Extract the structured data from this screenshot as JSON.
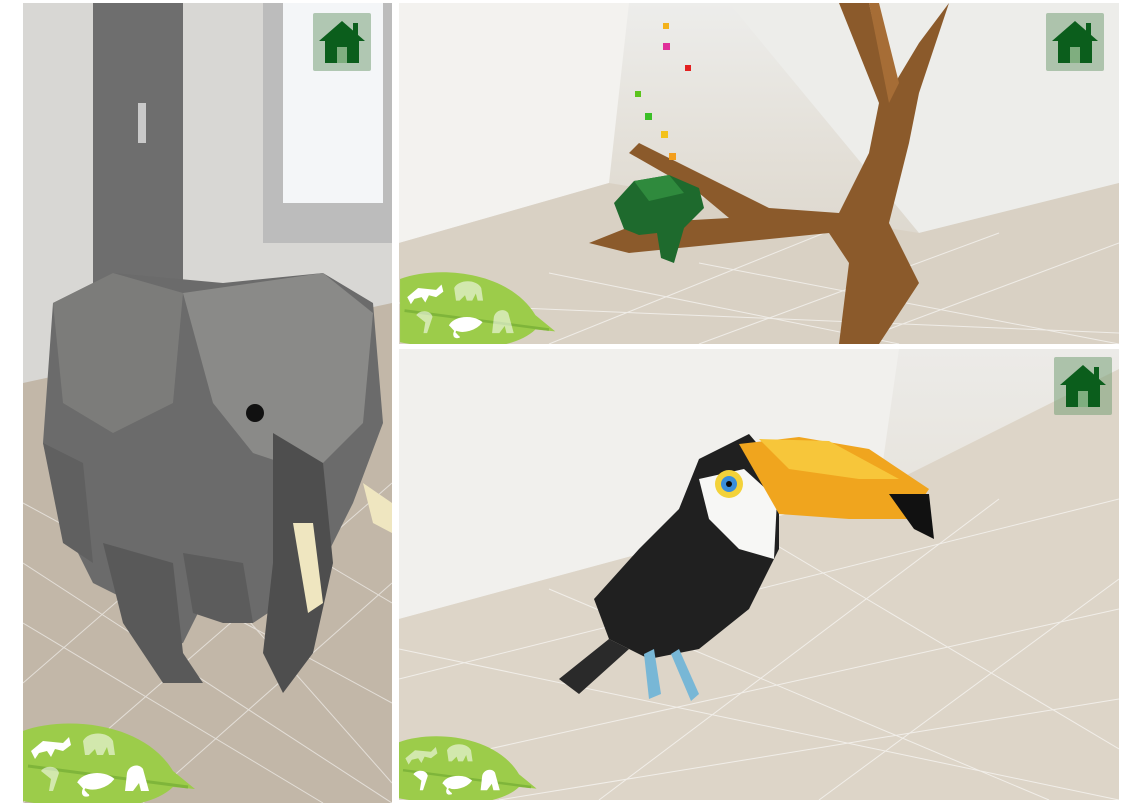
{
  "colors": {
    "home_icon": "#0b5e1c",
    "home_bg": "#7fae7f",
    "leaf": "#9ccc4a",
    "leaf_vein": "#7fb53a",
    "icon_white": "#ffffff"
  },
  "panels": [
    {
      "id": "elephant-panel",
      "animal": "elephant"
    },
    {
      "id": "chameleon-panel",
      "animal": "chameleon"
    },
    {
      "id": "toucan-panel",
      "animal": "toucan"
    }
  ],
  "toolbar": {
    "home_icon": "home-icon",
    "animal_icons": [
      "cheetah-icon",
      "elephant-icon",
      "toucan-icon",
      "chameleon-icon",
      "gorilla-icon"
    ]
  }
}
